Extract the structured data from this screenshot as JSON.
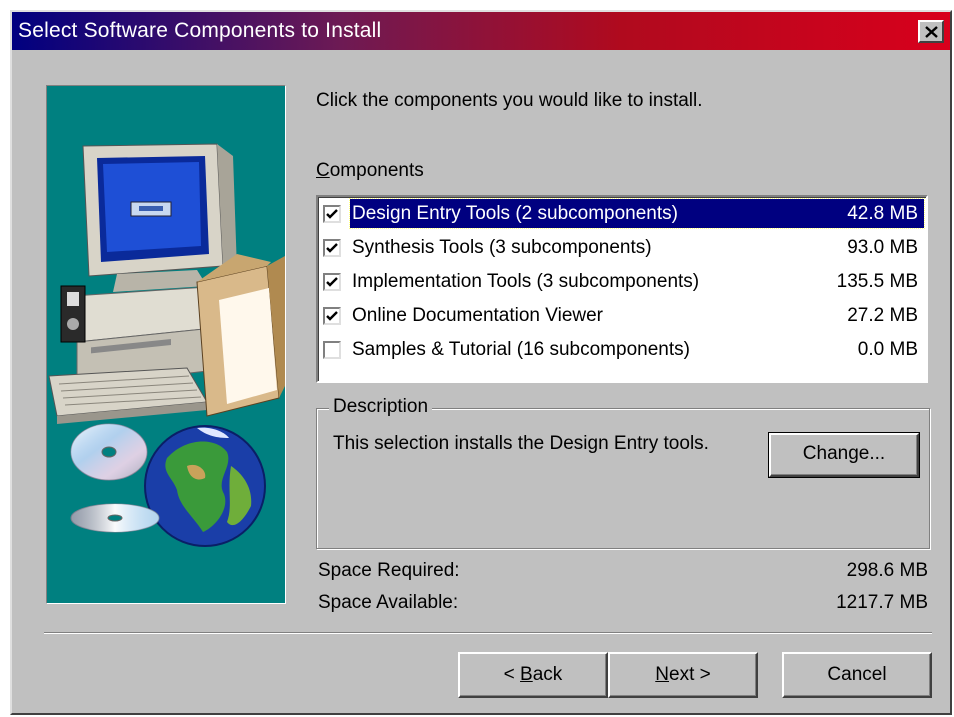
{
  "window": {
    "title": "Select Software Components to Install"
  },
  "instruction": "Click the components you would like to install.",
  "components": {
    "label_mnemonic": "C",
    "label_rest": "omponents",
    "items": [
      {
        "label": "Design Entry Tools (2 subcomponents)",
        "size": "42.8 MB",
        "checked": true,
        "selected": true
      },
      {
        "label": "Synthesis Tools (3 subcomponents)",
        "size": "93.0 MB",
        "checked": true,
        "selected": false
      },
      {
        "label": "Implementation Tools (3 subcomponents)",
        "size": "135.5 MB",
        "checked": true,
        "selected": false
      },
      {
        "label": "Online Documentation Viewer",
        "size": "27.2 MB",
        "checked": true,
        "selected": false
      },
      {
        "label": "Samples & Tutorial (16 subcomponents)",
        "size": "0.0 MB",
        "checked": false,
        "selected": false
      }
    ]
  },
  "description": {
    "legend": "Description",
    "text": "This selection installs the Design Entry tools.",
    "change_label": "Change..."
  },
  "space": {
    "required_label": "Space Required:",
    "required_value": "298.6 MB",
    "available_label": "Space Available:",
    "available_value": "1217.7 MB"
  },
  "buttons": {
    "back_prefix": "< ",
    "back_mnemonic": "B",
    "back_rest": "ack",
    "next_mnemonic": "N",
    "next_rest": "ext >",
    "cancel": "Cancel"
  },
  "colors": {
    "teal_panel": "#008080",
    "selection": "#000080",
    "dialog_face": "#c0c0c0"
  }
}
